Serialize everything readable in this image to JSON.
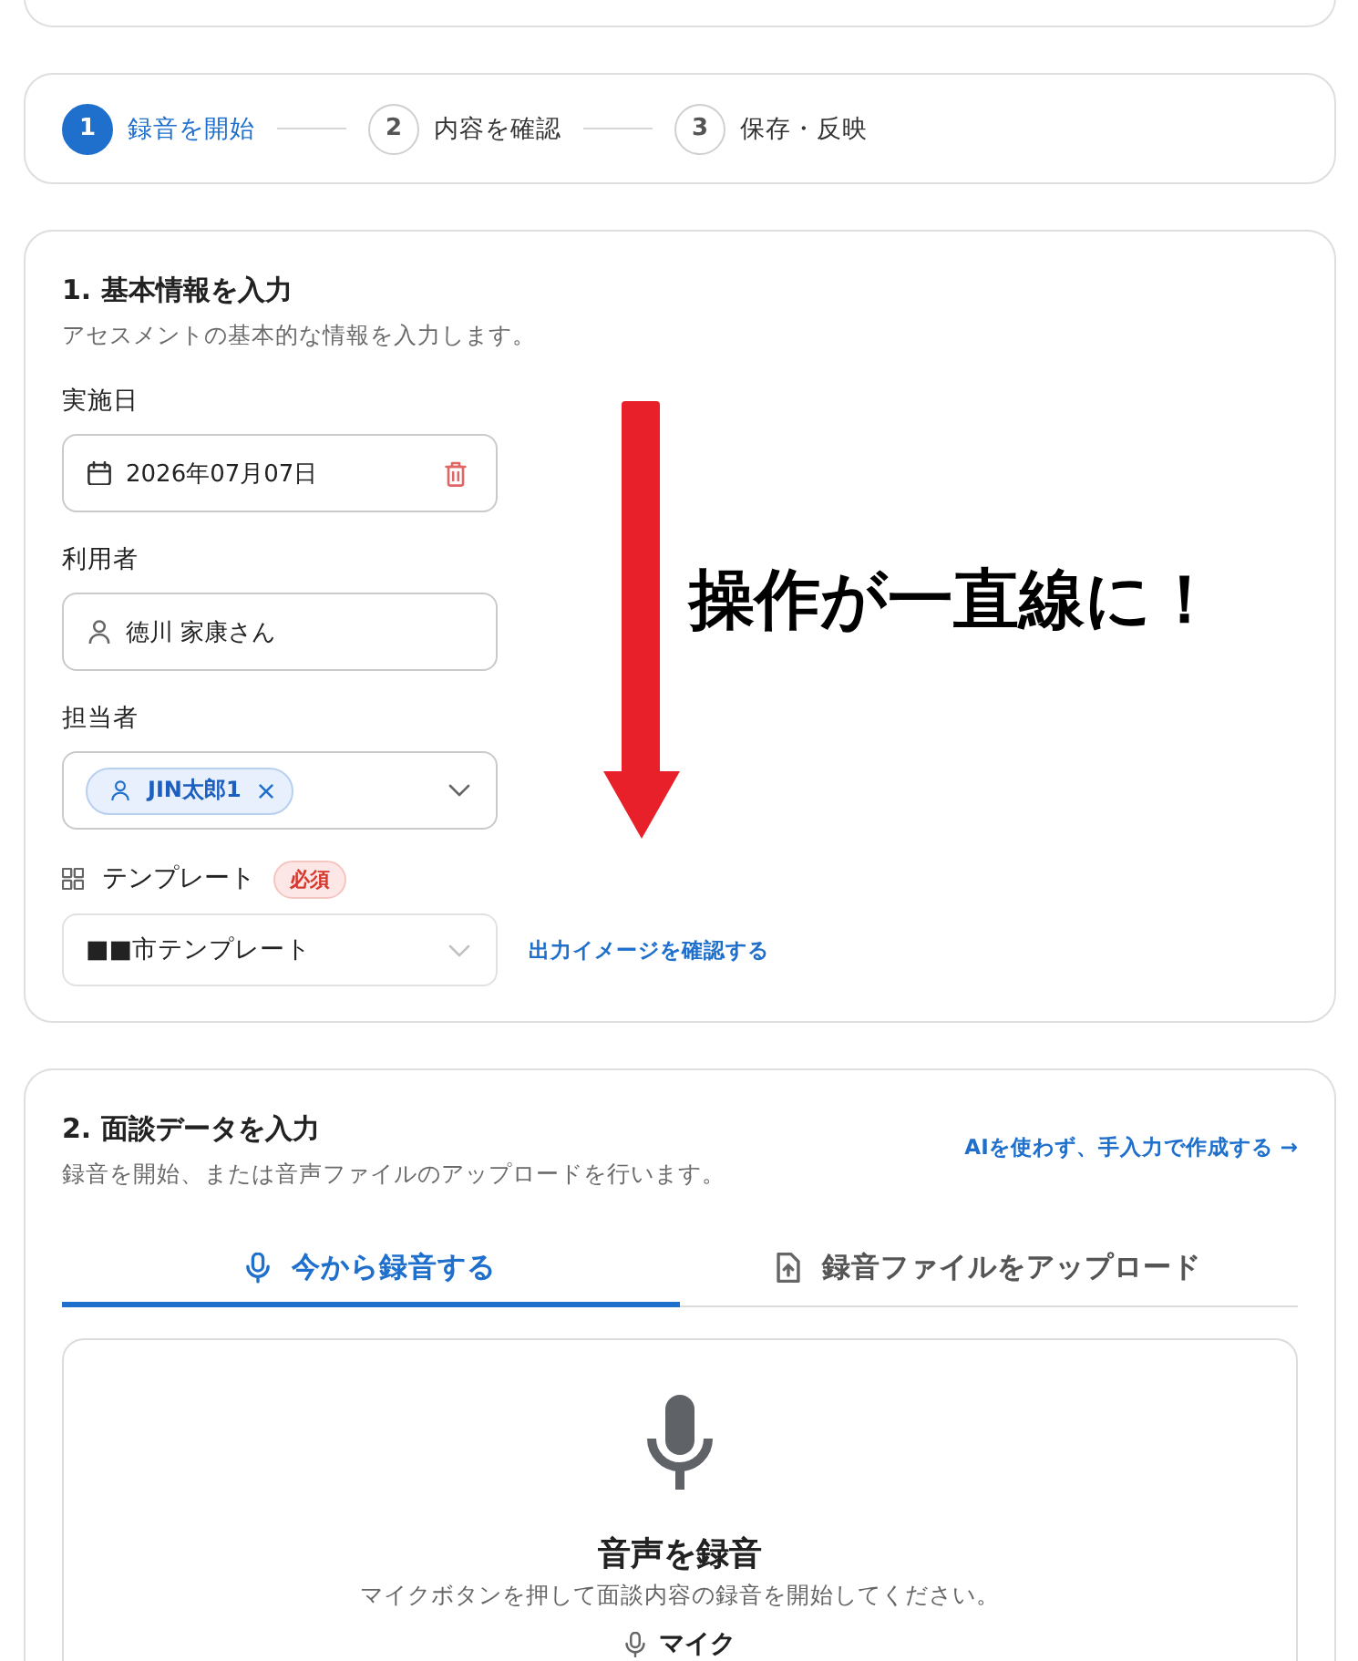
{
  "stepper": {
    "steps": [
      {
        "number": "1",
        "label": "録音を開始",
        "selected": true
      },
      {
        "number": "2",
        "label": "内容を確認",
        "selected": false
      },
      {
        "number": "3",
        "label": "保存・反映",
        "selected": false
      }
    ]
  },
  "basic_info": {
    "title": "1. 基本情報を入力",
    "subtitle": "アセスメントの基本的な情報を入力します。",
    "date": {
      "label": "実施日",
      "value": "2026年07月07日"
    },
    "client": {
      "label": "利用者",
      "value": "徳川 家康さん"
    },
    "assignee": {
      "label": "担当者",
      "chips": [
        "JIN太郎1"
      ]
    },
    "template": {
      "label": "テンプレート",
      "badge": "必須",
      "value": "■■市テンプレート",
      "link": "出力イメージを確認する"
    }
  },
  "annotation": {
    "text": "操作が一直線に！"
  },
  "interview_data": {
    "title": "2. 面談データを入力",
    "subtitle": "録音を開始、または音声ファイルのアップロードを行います。",
    "link": "AIを使わず、手入力で作成する →",
    "tabs": [
      {
        "label": "今から録音する",
        "selected": true
      },
      {
        "label": "録音ファイルをアップロード",
        "selected": false
      }
    ],
    "recorder": {
      "title": "音声を録音",
      "description": "マイクボタンを押して面談内容の録音を開始してください。",
      "device_label": "マイク"
    }
  }
}
